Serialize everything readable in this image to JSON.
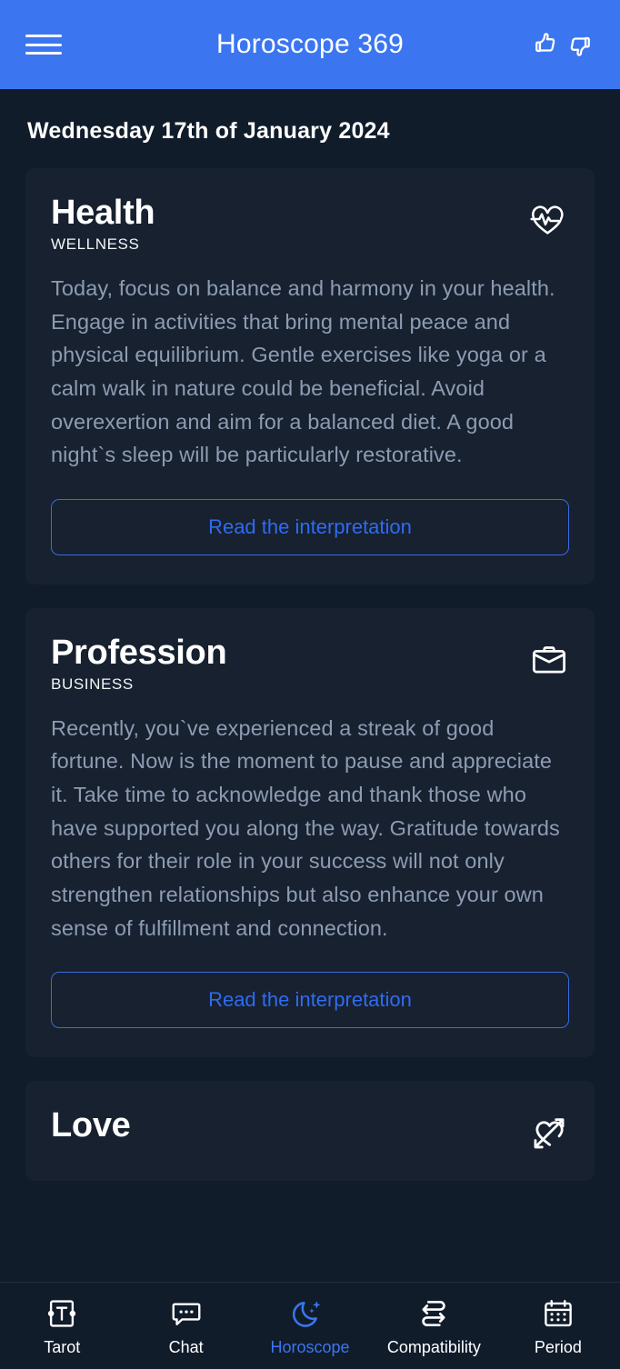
{
  "header": {
    "title": "Horoscope 369",
    "menu_icon": "hamburger-menu-icon",
    "like_icon": "thumbs-up-icon",
    "dislike_icon": "thumbs-down-icon",
    "background_color": "#3b76f0"
  },
  "page": {
    "date": "Wednesday 17th of January 2024",
    "background_color": "#111c2b",
    "card_color": "#17212f",
    "accent_color": "#3b76f0",
    "body_text_color": "#8d9cb3"
  },
  "cards": [
    {
      "title": "Health",
      "subtitle": "WELLNESS",
      "icon": "heart-pulse-icon",
      "text": "Today, focus on balance and harmony in your health. Engage in activities that bring mental peace and physical equilibrium. Gentle exercises like yoga or a calm walk in nature could be beneficial. Avoid overexertion and aim for a balanced diet. A good night`s sleep will be particularly restorative.",
      "button_label": "Read the interpretation"
    },
    {
      "title": "Profession",
      "subtitle": "BUSINESS",
      "icon": "briefcase-icon",
      "text": "Recently, you`ve experienced a streak of good fortune. Now is the moment to pause and appreciate it. Take time to acknowledge and thank those who have supported you along the way. Gratitude towards others for their role in your success will not only strengthen relationships but also enhance your own sense of fulfillment and connection.",
      "button_label": "Read the interpretation"
    },
    {
      "title": "Love",
      "subtitle": "",
      "icon": "heart-arrow-icon",
      "text": "",
      "button_label": ""
    }
  ],
  "bottom_nav": {
    "items": [
      {
        "label": "Tarot",
        "icon": "tarot-card-icon",
        "active": false
      },
      {
        "label": "Chat",
        "icon": "chat-bubble-icon",
        "active": false
      },
      {
        "label": "Horoscope",
        "icon": "moon-sparkle-icon",
        "active": true
      },
      {
        "label": "Compatibility",
        "icon": "swap-arrows-icon",
        "active": false
      },
      {
        "label": "Period",
        "icon": "calendar-icon",
        "active": false
      }
    ]
  }
}
